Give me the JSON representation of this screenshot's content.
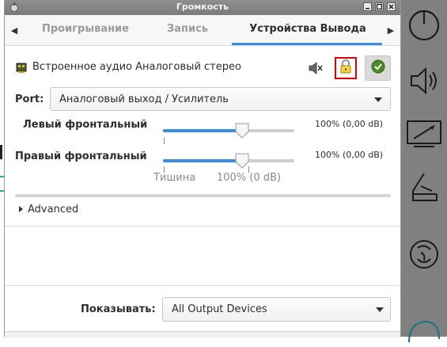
{
  "window": {
    "title": "Громкость"
  },
  "tabs": [
    {
      "label": "Проигрывание",
      "active": false
    },
    {
      "label": "Запись",
      "active": false
    },
    {
      "label": "Устройства Вывода",
      "active": true
    }
  ],
  "device": {
    "name": "Встроенное аудио Аналоговый стерео",
    "icons": {
      "device": "sound-card-icon",
      "mute": "speaker-muted-icon",
      "lock": "padlock-icon",
      "default": "checkmark-icon"
    }
  },
  "port": {
    "label": "Port:",
    "selected": "Аналоговый выход / Усилитель"
  },
  "channels": [
    {
      "label": "Левый фронтальный",
      "value_text": "100% (0,00 dB)",
      "level": 0.6
    },
    {
      "label": "Правый фронтальный",
      "value_text": "100% (0,00 dB)",
      "level": 0.6
    }
  ],
  "scale_marks": {
    "silence": "Тишина",
    "hundred": "100% (0 dB)"
  },
  "advanced": {
    "label": "Advanced"
  },
  "show": {
    "label": "Показывать:",
    "selected": "All Output Devices"
  },
  "colors": {
    "accent": "#3d8ee0",
    "highlight_box": "#e00000",
    "dock": "#808080"
  },
  "dock_icons": [
    "power-icon",
    "speaker-icon",
    "display-icon",
    "scanner-icon",
    "update-icon",
    "cloud-icon"
  ]
}
